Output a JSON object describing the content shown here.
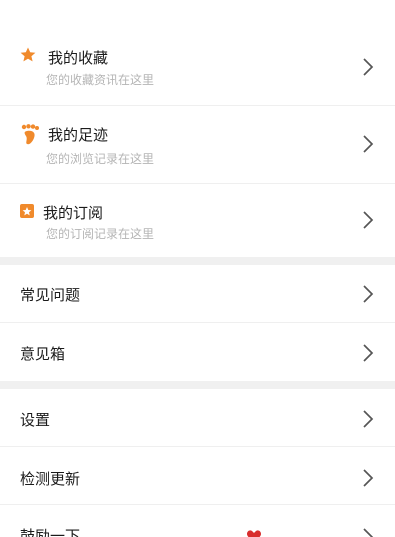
{
  "sections": [
    {
      "items": [
        {
          "icon": "star-icon",
          "title": "我的收藏",
          "subtitle": "您的收藏资讯在这里"
        },
        {
          "icon": "footprint-icon",
          "title": "我的足迹",
          "subtitle": "您的浏览记录在这里"
        },
        {
          "icon": "subscription-icon",
          "title": "我的订阅",
          "subtitle": "您的订阅记录在这里"
        }
      ]
    },
    {
      "items": [
        {
          "title": "常见问题"
        },
        {
          "title": "意见箱"
        }
      ]
    },
    {
      "items": [
        {
          "title": "设置"
        },
        {
          "title": "检测更新"
        },
        {
          "title": "鼓励一下"
        }
      ]
    }
  ],
  "colors": {
    "accent": "#f08a2c",
    "text": "#1b1b1b",
    "subtitle": "#b5b5b5",
    "gap": "#f0f0f0",
    "chevron": "#555555",
    "divider": "#efefef"
  }
}
